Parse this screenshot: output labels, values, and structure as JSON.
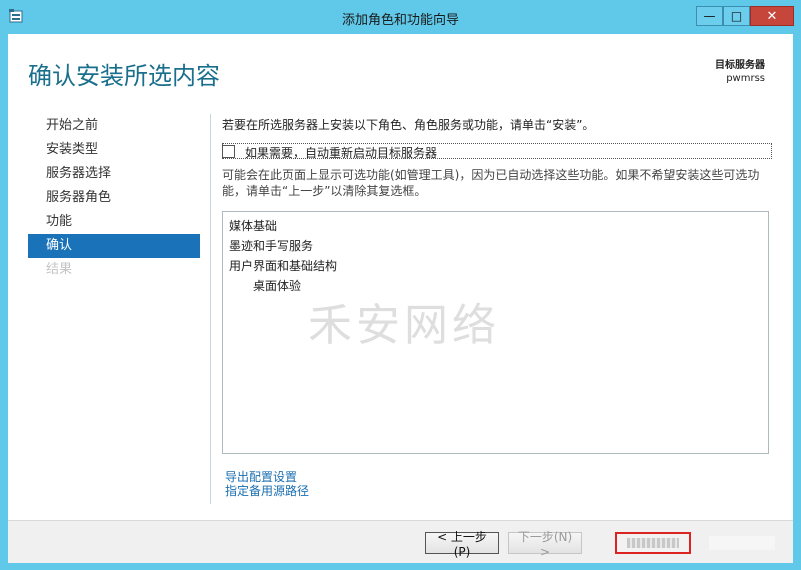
{
  "window": {
    "title": "添加角色和功能向导"
  },
  "controls": {
    "minimize": "—",
    "maximize": "□",
    "close": "✕"
  },
  "page": {
    "title": "确认安装所选内容"
  },
  "target_server": {
    "label": "目标服务器",
    "name": "pwmrss"
  },
  "nav": {
    "items": [
      {
        "label": "开始之前",
        "state": "normal"
      },
      {
        "label": "安装类型",
        "state": "normal"
      },
      {
        "label": "服务器选择",
        "state": "normal"
      },
      {
        "label": "服务器角色",
        "state": "normal"
      },
      {
        "label": "功能",
        "state": "normal"
      },
      {
        "label": "确认",
        "state": "active"
      },
      {
        "label": "结果",
        "state": "disabled"
      }
    ]
  },
  "content": {
    "intro": "若要在所选服务器上安装以下角色、角色服务或功能，请单击“安装”。",
    "restart_checkbox": {
      "label": "如果需要，自动重新启动目标服务器",
      "checked": false
    },
    "note": "可能会在此页面上显示可选功能(如管理工具)，因为已自动选择这些功能。如果不希望安装这些可选功能，请单击“上一步”以清除其复选框。",
    "selections": [
      {
        "label": "媒体基础",
        "level": 0
      },
      {
        "label": "墨迹和手写服务",
        "level": 0
      },
      {
        "label": "用户界面和基础结构",
        "level": 0
      },
      {
        "label": "桌面体验",
        "level": 1
      }
    ],
    "links": {
      "export": "导出配置设置",
      "alt_source": "指定备用源路径"
    }
  },
  "watermark": "禾安网络",
  "footer": {
    "prev": "< 上一步(P)",
    "next": "下一步(N) >"
  }
}
